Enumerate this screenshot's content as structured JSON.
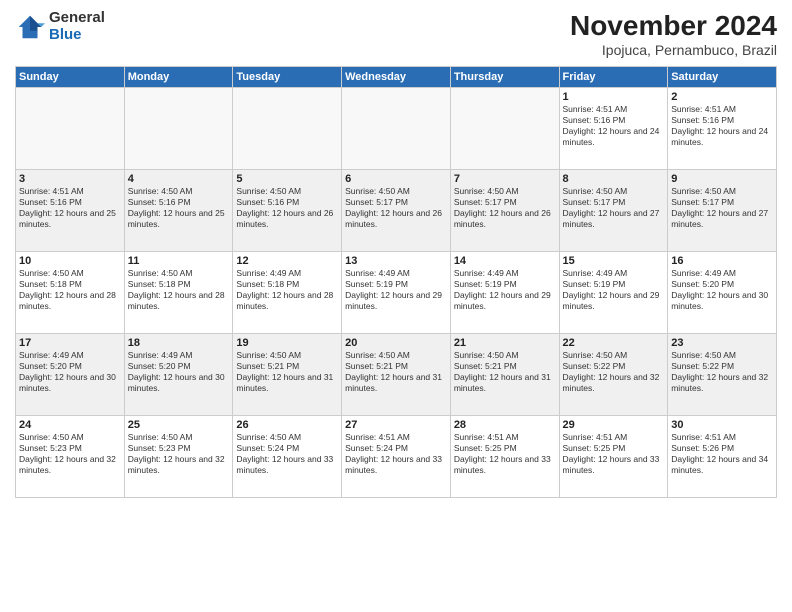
{
  "logo": {
    "general": "General",
    "blue": "Blue"
  },
  "title": "November 2024",
  "location": "Ipojuca, Pernambuco, Brazil",
  "days_of_week": [
    "Sunday",
    "Monday",
    "Tuesday",
    "Wednesday",
    "Thursday",
    "Friday",
    "Saturday"
  ],
  "weeks": [
    [
      {
        "day": "",
        "info": ""
      },
      {
        "day": "",
        "info": ""
      },
      {
        "day": "",
        "info": ""
      },
      {
        "day": "",
        "info": ""
      },
      {
        "day": "",
        "info": ""
      },
      {
        "day": "1",
        "info": "Sunrise: 4:51 AM\nSunset: 5:16 PM\nDaylight: 12 hours and 24 minutes."
      },
      {
        "day": "2",
        "info": "Sunrise: 4:51 AM\nSunset: 5:16 PM\nDaylight: 12 hours and 24 minutes."
      }
    ],
    [
      {
        "day": "3",
        "info": "Sunrise: 4:51 AM\nSunset: 5:16 PM\nDaylight: 12 hours and 25 minutes."
      },
      {
        "day": "4",
        "info": "Sunrise: 4:50 AM\nSunset: 5:16 PM\nDaylight: 12 hours and 25 minutes."
      },
      {
        "day": "5",
        "info": "Sunrise: 4:50 AM\nSunset: 5:16 PM\nDaylight: 12 hours and 26 minutes."
      },
      {
        "day": "6",
        "info": "Sunrise: 4:50 AM\nSunset: 5:17 PM\nDaylight: 12 hours and 26 minutes."
      },
      {
        "day": "7",
        "info": "Sunrise: 4:50 AM\nSunset: 5:17 PM\nDaylight: 12 hours and 26 minutes."
      },
      {
        "day": "8",
        "info": "Sunrise: 4:50 AM\nSunset: 5:17 PM\nDaylight: 12 hours and 27 minutes."
      },
      {
        "day": "9",
        "info": "Sunrise: 4:50 AM\nSunset: 5:17 PM\nDaylight: 12 hours and 27 minutes."
      }
    ],
    [
      {
        "day": "10",
        "info": "Sunrise: 4:50 AM\nSunset: 5:18 PM\nDaylight: 12 hours and 28 minutes."
      },
      {
        "day": "11",
        "info": "Sunrise: 4:50 AM\nSunset: 5:18 PM\nDaylight: 12 hours and 28 minutes."
      },
      {
        "day": "12",
        "info": "Sunrise: 4:49 AM\nSunset: 5:18 PM\nDaylight: 12 hours and 28 minutes."
      },
      {
        "day": "13",
        "info": "Sunrise: 4:49 AM\nSunset: 5:19 PM\nDaylight: 12 hours and 29 minutes."
      },
      {
        "day": "14",
        "info": "Sunrise: 4:49 AM\nSunset: 5:19 PM\nDaylight: 12 hours and 29 minutes."
      },
      {
        "day": "15",
        "info": "Sunrise: 4:49 AM\nSunset: 5:19 PM\nDaylight: 12 hours and 29 minutes."
      },
      {
        "day": "16",
        "info": "Sunrise: 4:49 AM\nSunset: 5:20 PM\nDaylight: 12 hours and 30 minutes."
      }
    ],
    [
      {
        "day": "17",
        "info": "Sunrise: 4:49 AM\nSunset: 5:20 PM\nDaylight: 12 hours and 30 minutes."
      },
      {
        "day": "18",
        "info": "Sunrise: 4:49 AM\nSunset: 5:20 PM\nDaylight: 12 hours and 30 minutes."
      },
      {
        "day": "19",
        "info": "Sunrise: 4:50 AM\nSunset: 5:21 PM\nDaylight: 12 hours and 31 minutes."
      },
      {
        "day": "20",
        "info": "Sunrise: 4:50 AM\nSunset: 5:21 PM\nDaylight: 12 hours and 31 minutes."
      },
      {
        "day": "21",
        "info": "Sunrise: 4:50 AM\nSunset: 5:21 PM\nDaylight: 12 hours and 31 minutes."
      },
      {
        "day": "22",
        "info": "Sunrise: 4:50 AM\nSunset: 5:22 PM\nDaylight: 12 hours and 32 minutes."
      },
      {
        "day": "23",
        "info": "Sunrise: 4:50 AM\nSunset: 5:22 PM\nDaylight: 12 hours and 32 minutes."
      }
    ],
    [
      {
        "day": "24",
        "info": "Sunrise: 4:50 AM\nSunset: 5:23 PM\nDaylight: 12 hours and 32 minutes."
      },
      {
        "day": "25",
        "info": "Sunrise: 4:50 AM\nSunset: 5:23 PM\nDaylight: 12 hours and 32 minutes."
      },
      {
        "day": "26",
        "info": "Sunrise: 4:50 AM\nSunset: 5:24 PM\nDaylight: 12 hours and 33 minutes."
      },
      {
        "day": "27",
        "info": "Sunrise: 4:51 AM\nSunset: 5:24 PM\nDaylight: 12 hours and 33 minutes."
      },
      {
        "day": "28",
        "info": "Sunrise: 4:51 AM\nSunset: 5:25 PM\nDaylight: 12 hours and 33 minutes."
      },
      {
        "day": "29",
        "info": "Sunrise: 4:51 AM\nSunset: 5:25 PM\nDaylight: 12 hours and 33 minutes."
      },
      {
        "day": "30",
        "info": "Sunrise: 4:51 AM\nSunset: 5:26 PM\nDaylight: 12 hours and 34 minutes."
      }
    ]
  ]
}
